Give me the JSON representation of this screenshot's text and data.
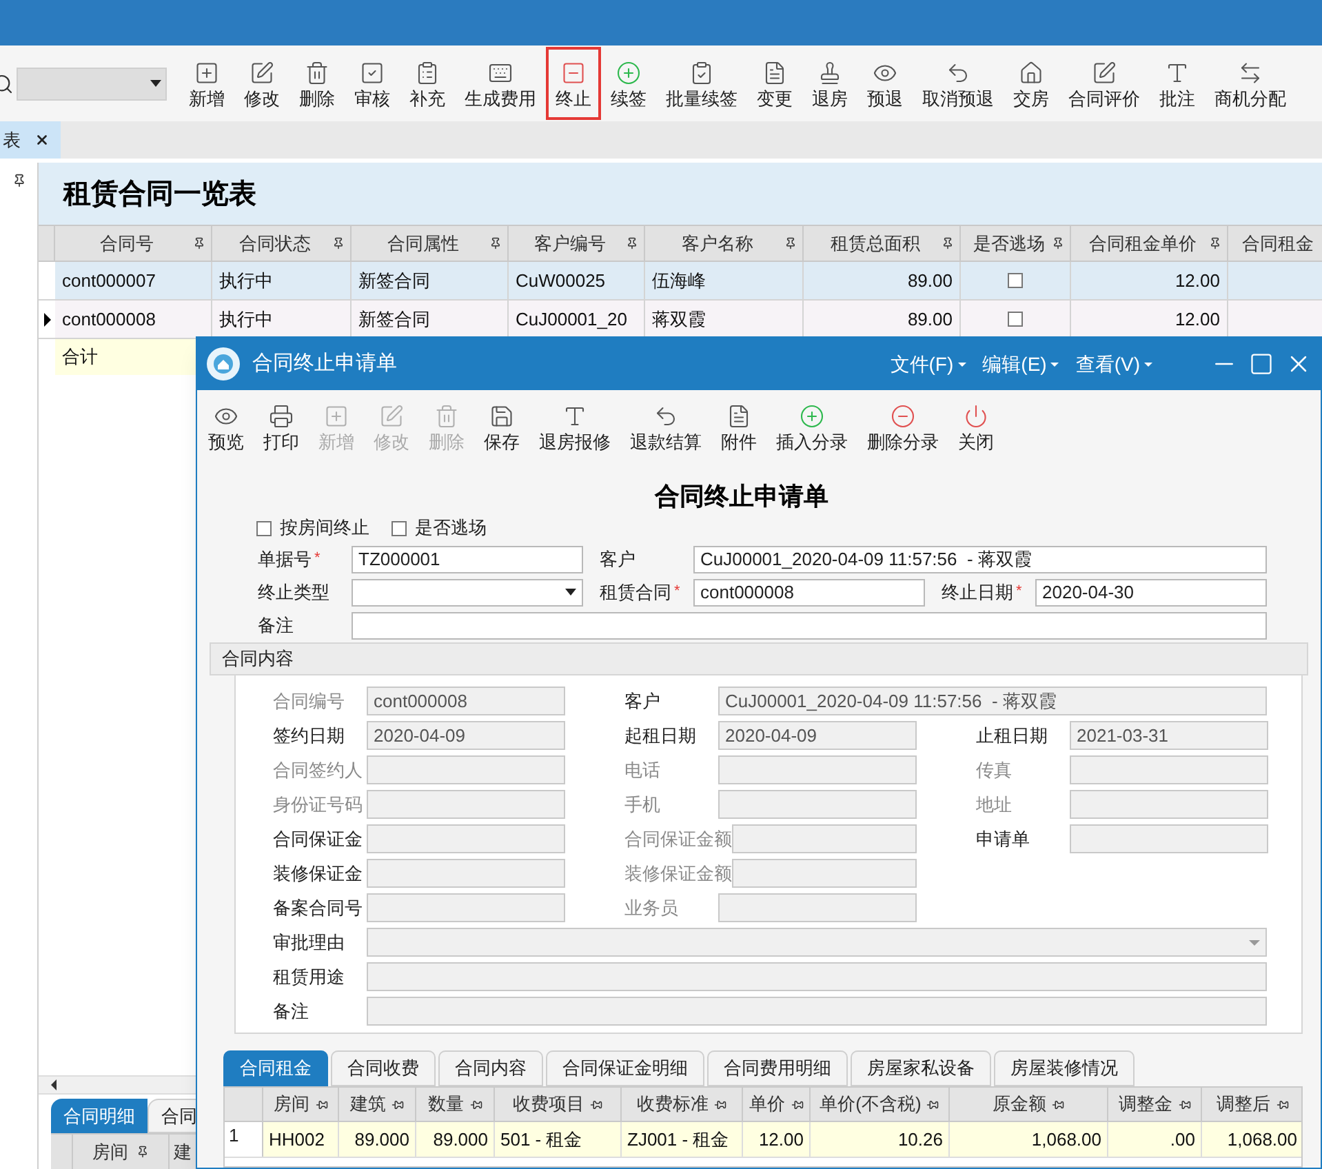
{
  "toolbar": [
    {
      "label": "新增",
      "highlighted": false
    },
    {
      "label": "修改",
      "highlighted": false
    },
    {
      "label": "删除",
      "highlighted": false
    },
    {
      "label": "审核",
      "highlighted": false
    },
    {
      "label": "补充",
      "highlighted": false
    },
    {
      "label": "生成费用",
      "highlighted": false
    },
    {
      "label": "终止",
      "highlighted": true
    },
    {
      "label": "续签",
      "highlighted": false
    },
    {
      "label": "批量续签",
      "highlighted": false
    },
    {
      "label": "变更",
      "highlighted": false
    },
    {
      "label": "退房",
      "highlighted": false
    },
    {
      "label": "预退",
      "highlighted": false
    },
    {
      "label": "取消预退",
      "highlighted": false
    },
    {
      "label": "交房",
      "highlighted": false
    },
    {
      "label": "合同评价",
      "highlighted": false
    },
    {
      "label": "批注",
      "highlighted": false
    },
    {
      "label": "商机分配",
      "highlighted": false
    }
  ],
  "tabs": [
    {
      "label": "表",
      "selected": true
    }
  ],
  "list": {
    "title": "租赁合同一览表",
    "columns": [
      {
        "label": "合同号",
        "kind": "text"
      },
      {
        "label": "合同状态",
        "kind": "text"
      },
      {
        "label": "合同属性",
        "kind": "text"
      },
      {
        "label": "客户编号",
        "kind": "text"
      },
      {
        "label": "客户名称",
        "kind": "text"
      },
      {
        "label": "租赁总面积",
        "kind": "number"
      },
      {
        "label": "是否逃场",
        "kind": "check"
      },
      {
        "label": "合同租金单价",
        "kind": "number"
      },
      {
        "label": "合同租金",
        "kind": "text"
      }
    ],
    "rows": [
      {
        "selected": true,
        "current": false,
        "cells": [
          {
            "text": "cont000007"
          },
          {
            "text": "执行中"
          },
          {
            "text": "新签合同"
          },
          {
            "text": "CuW00025"
          },
          {
            "text": "伍海峰"
          },
          {
            "text": "89.00"
          },
          {
            "checked": false
          },
          {
            "text": "12.00"
          }
        ]
      },
      {
        "selected": false,
        "current": true,
        "cells": [
          {
            "text": "cont000008"
          },
          {
            "text": "执行中"
          },
          {
            "text": "新签合同"
          },
          {
            "text": "CuJ00001_20"
          },
          {
            "text": "蒋双霞"
          },
          {
            "text": "89.00"
          },
          {
            "checked": false
          },
          {
            "text": "12.00"
          }
        ]
      }
    ],
    "total_label": "合计"
  },
  "detail_tabs": [
    {
      "label": "合同明细",
      "selected": true
    },
    {
      "label": "合同",
      "selected": false
    }
  ],
  "detail_columns": [
    "房间",
    "建"
  ],
  "dialog": {
    "title": "合同终止申请单",
    "menus": [
      "文件(F)",
      "编辑(E)",
      "查看(V)"
    ],
    "toolbar": [
      {
        "label": "预览",
        "disabled": false
      },
      {
        "label": "打印",
        "disabled": false
      },
      {
        "label": "新增",
        "disabled": true
      },
      {
        "label": "修改",
        "disabled": true
      },
      {
        "label": "删除",
        "disabled": true
      },
      {
        "label": "保存",
        "disabled": false
      },
      {
        "label": "退房报修",
        "disabled": false
      },
      {
        "label": "退款结算",
        "disabled": false
      },
      {
        "label": "附件",
        "disabled": false
      },
      {
        "label": "插入分录",
        "disabled": false
      },
      {
        "label": "删除分录",
        "disabled": false
      },
      {
        "label": "关闭",
        "disabled": false
      }
    ],
    "form_title": "合同终止申请单",
    "options": [
      {
        "label": "按房间终止",
        "checked": false
      },
      {
        "label": "是否逃场",
        "checked": false
      }
    ],
    "header_rows": [
      [
        {
          "label": "单据号",
          "required_mark": "*",
          "kind": "text",
          "value": "TZ000001"
        },
        {
          "label": "客户",
          "kind": "text_wide",
          "value": "CuJ00001_2020-04-09 11:57:56  - 蒋双霞"
        }
      ],
      [
        {
          "label": "终止类型",
          "kind": "select"
        },
        {
          "label": "租赁合同",
          "required_mark": "*",
          "kind": "text",
          "value": "cont000008"
        },
        {
          "label": "终止日期",
          "required_mark": "*",
          "kind": "text",
          "value": "2020-04-30"
        }
      ],
      [
        {
          "label": "备注",
          "kind": "text_full"
        }
      ]
    ],
    "section_title": "合同内容",
    "section_rows": [
      [
        {
          "label": "合同编号",
          "greyed": true,
          "kind": "text",
          "value": "cont000008"
        },
        {
          "label": "客户",
          "greyed": false,
          "kind": "text_wide",
          "value": "CuJ00001_2020-04-09 11:57:56  - 蒋双霞"
        }
      ],
      [
        {
          "label": "签约日期",
          "greyed": false,
          "kind": "text",
          "value": "2020-04-09"
        },
        {
          "label": "起租日期",
          "greyed": false,
          "kind": "text",
          "value": "2020-04-09"
        },
        {
          "label": "止租日期",
          "greyed": false,
          "kind": "text",
          "value": "2021-03-31"
        }
      ],
      [
        {
          "label": "合同签约人",
          "greyed": true,
          "kind": "text"
        },
        {
          "label": "电话",
          "greyed": true,
          "kind": "text"
        },
        {
          "label": "传真",
          "greyed": true,
          "kind": "text"
        }
      ],
      [
        {
          "label": "身份证号码",
          "greyed": true,
          "kind": "text"
        },
        {
          "label": "手机",
          "greyed": true,
          "kind": "text"
        },
        {
          "label": "地址",
          "greyed": true,
          "kind": "text"
        }
      ],
      [
        {
          "label": "合同保证金",
          "greyed": false,
          "kind": "text"
        },
        {
          "label": "合同保证金额",
          "greyed": true,
          "kind": "text"
        },
        {
          "label": "申请单",
          "greyed": false,
          "kind": "text"
        }
      ],
      [
        {
          "label": "装修保证金",
          "greyed": false,
          "kind": "text"
        },
        {
          "label": "装修保证金额",
          "greyed": true,
          "kind": "text"
        }
      ],
      [
        {
          "label": "备案合同号",
          "greyed": false,
          "kind": "text"
        },
        {
          "label": "业务员",
          "greyed": true,
          "kind": "text"
        }
      ],
      [
        {
          "label": "审批理由",
          "greyed": false,
          "kind": "select_full"
        }
      ],
      [
        {
          "label": "租赁用途",
          "greyed": false,
          "kind": "text_full"
        }
      ],
      [
        {
          "label": "备注",
          "greyed": false,
          "kind": "text_full"
        }
      ]
    ],
    "tabs": [
      {
        "label": "合同租金",
        "selected": true
      },
      {
        "label": "合同收费",
        "selected": false
      },
      {
        "label": "合同内容",
        "selected": false
      },
      {
        "label": "合同保证金明细",
        "selected": false
      },
      {
        "label": "合同费用明细",
        "selected": false
      },
      {
        "label": "房屋家私设备",
        "selected": false
      },
      {
        "label": "房屋装修情况",
        "selected": false
      }
    ],
    "grid": {
      "columns": [
        {
          "label": "房间",
          "kind": "text"
        },
        {
          "label": "建筑",
          "kind": "number"
        },
        {
          "label": "数量",
          "kind": "number"
        },
        {
          "label": "收费项目",
          "kind": "text"
        },
        {
          "label": "收费标准",
          "kind": "text"
        },
        {
          "label": "单价",
          "kind": "number"
        },
        {
          "label": "单价(不含税)",
          "kind": "number"
        },
        {
          "label": "原金额",
          "kind": "number"
        },
        {
          "label": "调整金",
          "kind": "number"
        },
        {
          "label": "调整后",
          "kind": "number"
        }
      ],
      "rows": [
        {
          "index": "1",
          "cells": [
            "HH002",
            "89.000",
            "89.000",
            "501 - 租金",
            "ZJ001 - 租金",
            "12.00",
            "10.26",
            "1,068.00",
            ".00",
            "1,068.00"
          ]
        }
      ]
    }
  }
}
